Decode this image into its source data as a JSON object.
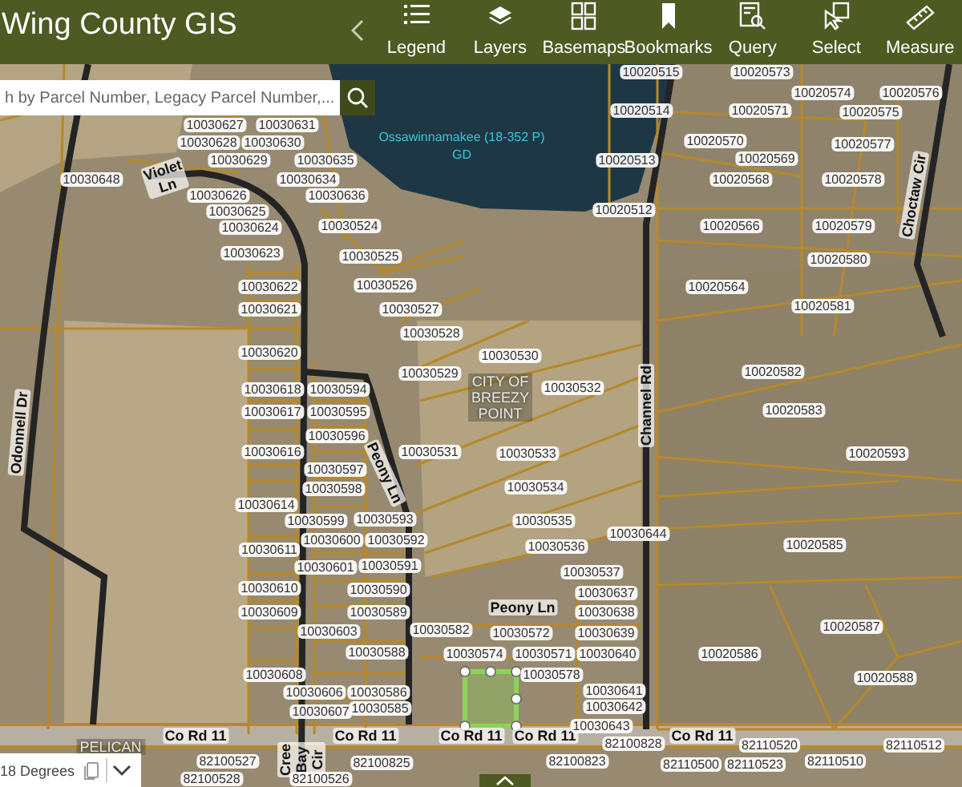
{
  "header": {
    "title": "Wing County GIS"
  },
  "toolbar": [
    {
      "label": "Legend",
      "kind": "legend"
    },
    {
      "label": "Layers",
      "kind": "layers"
    },
    {
      "label": "Basemaps",
      "kind": "basemaps"
    },
    {
      "label": "Bookmarks",
      "kind": "bookmarks"
    },
    {
      "label": "Query",
      "kind": "query"
    },
    {
      "label": "Select",
      "kind": "select"
    },
    {
      "label": "Measure",
      "kind": "measure"
    }
  ],
  "search": {
    "placeholder": "h by Parcel Number, Legacy Parcel Number,..."
  },
  "map": {
    "lake_label": {
      "lines": [
        "Ossawinnamakee (18-352 P)",
        "GD"
      ]
    },
    "place_labels": [
      {
        "lines": [
          "CITY OF",
          "BREEZY",
          "POINT"
        ]
      },
      {
        "lines": [
          "PELICAN"
        ]
      }
    ],
    "road_labels": [
      "Violet Ln",
      "Choctaw Cir",
      "Odonnell Dr",
      "Peony Ln",
      "Channel Rd",
      "Peony Ln",
      "Co Rd 11",
      "Co Rd 11",
      "Co Rd 11",
      "Co Rd 11",
      "Co Rd 11",
      "Cree Bay Cir"
    ],
    "parcel_labels": [
      "10020515",
      "10020573",
      "10020574",
      "10020576",
      "10020514",
      "10020571",
      "10020575",
      "10030627",
      "10030631",
      "10030628",
      "10030630",
      "10020570",
      "10020577",
      "10030629",
      "10030635",
      "10020513",
      "10020569",
      "10030648",
      "10030634",
      "10020568",
      "10020578",
      "10030626",
      "10030636",
      "10030625",
      "10020512",
      "10030624",
      "10030524",
      "10020566",
      "10020579",
      "10030623",
      "10030525",
      "10020580",
      "10030622",
      "10030526",
      "10020564",
      "10030621",
      "10030527",
      "10020581",
      "10030528",
      "10030620",
      "10030530",
      "10030529",
      "10020582",
      "10030618",
      "10030594",
      "10030532",
      "10030617",
      "10030595",
      "10020583",
      "10030596",
      "10030616",
      "10030531",
      "10030533",
      "10020593",
      "10030597",
      "10030598",
      "10030534",
      "10030614",
      "10030599",
      "10030593",
      "10030535",
      "10030611",
      "10030600",
      "10030592",
      "10030536",
      "10030644",
      "10020585",
      "10030601",
      "10030591",
      "10030537",
      "10030610",
      "10030590",
      "10030637",
      "10030609",
      "10030589",
      "10030638",
      "10030603",
      "10030582",
      "10030572",
      "10030639",
      "10020587",
      "10030588",
      "10030574",
      "10030571",
      "10030640",
      "10020586",
      "10030608",
      "10030578",
      "10020588",
      "10030606",
      "10030586",
      "10030641",
      "10030607",
      "10030585",
      "10030642",
      "10030643",
      "82100828",
      "82110520",
      "82110512",
      "82100527",
      "82100825",
      "82100823",
      "82110500",
      "82110523",
      "82110510",
      "82100528",
      "82100526"
    ]
  },
  "scale": {
    "text": "18 Degrees"
  }
}
